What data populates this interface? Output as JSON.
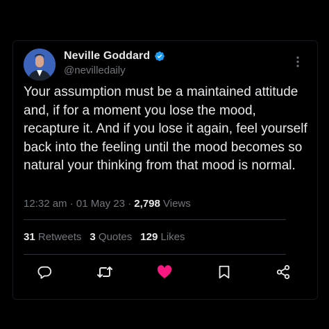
{
  "author": {
    "display_name": "Neville Goddard",
    "handle": "@nevilledaily",
    "verified": true,
    "avatar": "avatar-photo"
  },
  "tweet": {
    "text": "Your assumption must be a maintained attitude and, if for a moment you lose the mood, recapture it. And if you lose it again, feel yourself back into the feeling until the mood becomes so natural your thinking from that mood is normal."
  },
  "meta": {
    "time": "12:32 am",
    "separator": "·",
    "date": "01 May 23",
    "views_count": "2,798",
    "views_label": "Views"
  },
  "stats": {
    "retweets_count": "31",
    "retweets_label": "Retweets",
    "quotes_count": "3",
    "quotes_label": "Quotes",
    "likes_count": "129",
    "likes_label": "Likes"
  },
  "actions": [
    {
      "name": "reply",
      "icon": "reply-icon"
    },
    {
      "name": "retweet",
      "icon": "retweet-icon"
    },
    {
      "name": "like",
      "icon": "heart-icon",
      "active": true
    },
    {
      "name": "bookmark",
      "icon": "bookmark-icon"
    },
    {
      "name": "share",
      "icon": "share-icon"
    }
  ],
  "colors": {
    "background": "#000000",
    "text_primary": "#e7e9ea",
    "text_secondary": "#71767b",
    "verified_blue": "#1d9bf0",
    "like_pink": "#f91880",
    "divider": "#2f3336"
  }
}
